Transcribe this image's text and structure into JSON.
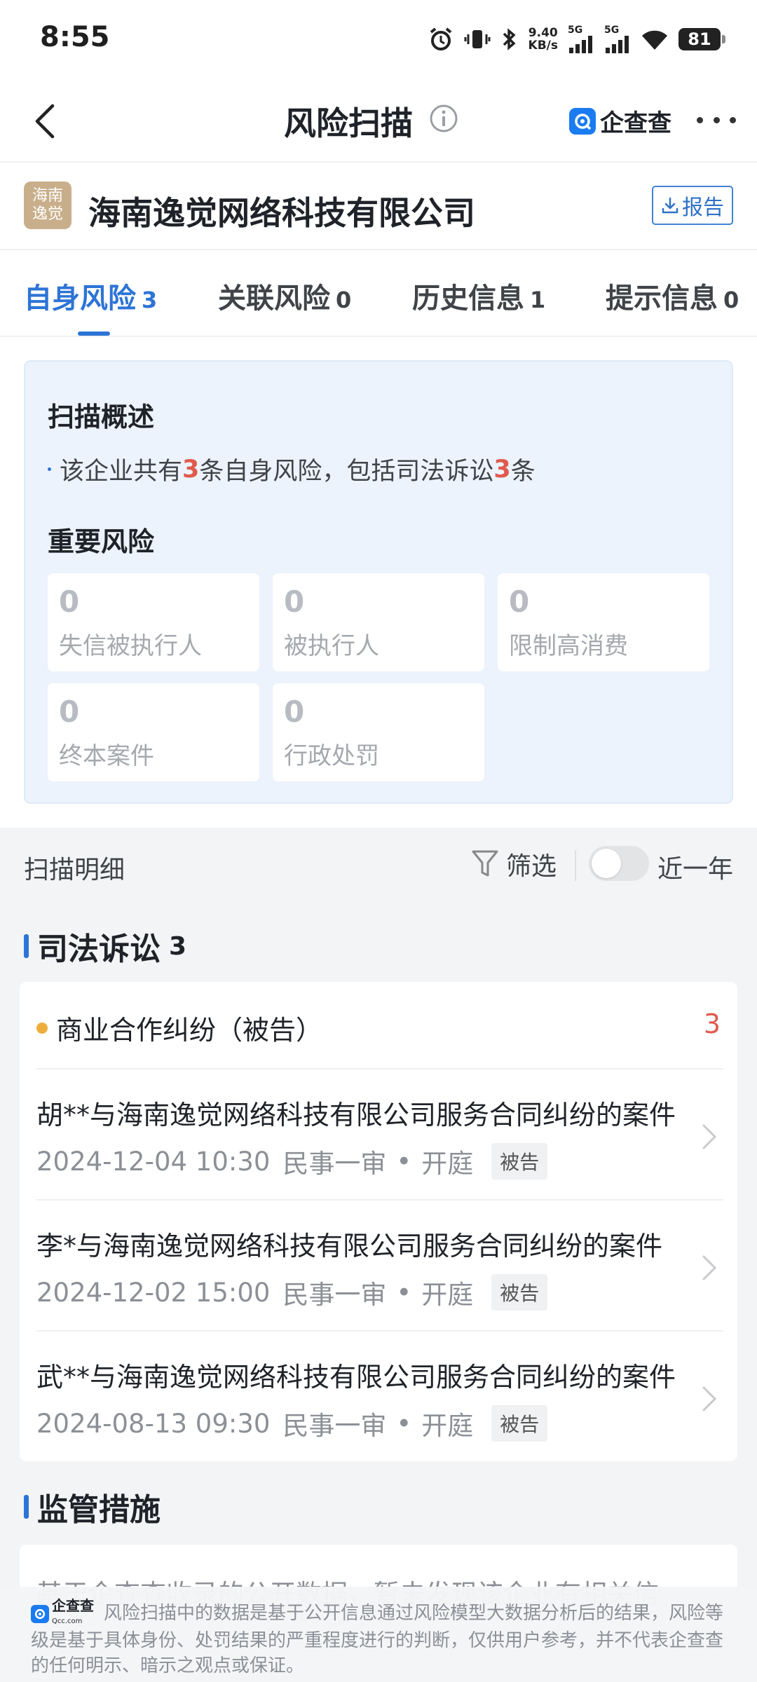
{
  "status_bar": {
    "time": "8:55",
    "net_speed_value": "9.40",
    "net_speed_unit": "KB/s",
    "sim1": "5G",
    "sim2": "5G",
    "battery": "81"
  },
  "nav": {
    "title": "风险扫描",
    "brand": "企查查"
  },
  "company": {
    "logo_line1": "海南",
    "logo_line2": "逸觉",
    "name": "海南逸觉网络科技有限公司",
    "report_label": "报告"
  },
  "tabs": [
    {
      "label": "自身风险",
      "count": "3"
    },
    {
      "label": "关联风险",
      "count": "0"
    },
    {
      "label": "历史信息",
      "count": "1"
    },
    {
      "label": "提示信息",
      "count": "0"
    }
  ],
  "overview": {
    "title": "扫描概述",
    "summary_part1": "该企业共有",
    "summary_num1": "3",
    "summary_part2": "条自身风险，包括司法诉讼",
    "summary_num2": "3",
    "summary_part3": "条",
    "important_title": "重要风险",
    "risks": [
      {
        "value": "0",
        "label": "失信被执行人"
      },
      {
        "value": "0",
        "label": "被执行人"
      },
      {
        "value": "0",
        "label": "限制高消费"
      },
      {
        "value": "0",
        "label": "终本案件"
      },
      {
        "value": "0",
        "label": "行政处罚"
      }
    ]
  },
  "detail": {
    "title": "扫描明细",
    "filter_label": "筛选",
    "toggle_label": "近一年"
  },
  "lawsuit": {
    "title": "司法诉讼",
    "count": "3",
    "type_label": "商业合作纠纷（被告）",
    "type_count": "3",
    "cases": [
      {
        "title": "胡**与海南逸觉网络科技有限公司服务合同纠纷的案件",
        "date": "2024-12-04 10:30",
        "stage": "民事一审",
        "status": "开庭",
        "role": "被告"
      },
      {
        "title": "李*与海南逸觉网络科技有限公司服务合同纠纷的案件",
        "date": "2024-12-02 15:00",
        "stage": "民事一审",
        "status": "开庭",
        "role": "被告"
      },
      {
        "title": "武**与海南逸觉网络科技有限公司服务合同纠纷的案件",
        "date": "2024-08-13 09:30",
        "stage": "民事一审",
        "status": "开庭",
        "role": "被告"
      }
    ]
  },
  "regulatory": {
    "title": "监管措施",
    "text": "基于企查查收录的公开数据，暂未发现该企业有相关信"
  },
  "disclaimer": {
    "logo_text": "企查查",
    "logo_sub": "Qcc.com",
    "text": "风险扫描中的数据是基于公开信息通过风险模型大数据分析后的结果，风险等级是基于具体身份、处罚结果的严重程度进行的判断，仅供用户参考，并不代表企查查的任何明示、暗示之观点或保证。"
  },
  "colors": {
    "accent": "#2d74d6",
    "risk_red": "#e05a4e",
    "dot_yellow": "#eeae3c",
    "overview_bg": "#ecf3fc"
  }
}
